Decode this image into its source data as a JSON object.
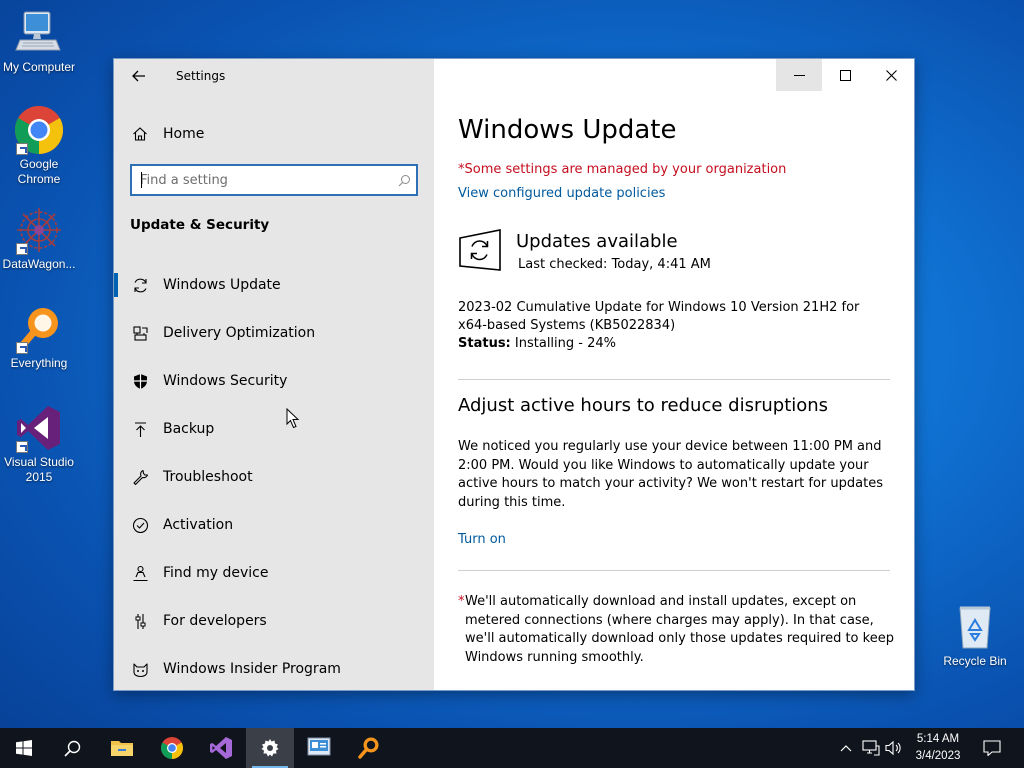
{
  "desktop": {
    "icons": [
      {
        "label": "My Computer"
      },
      {
        "label": "Google Chrome"
      },
      {
        "label": "DataWagon..."
      },
      {
        "label": "Everything"
      },
      {
        "label": "Visual Studio 2015"
      },
      {
        "label": "Recycle Bin"
      }
    ]
  },
  "window": {
    "title": "Settings",
    "controls": {
      "minimize": "minimize-icon",
      "maximize": "maximize-icon",
      "close": "close-icon"
    }
  },
  "sidebar": {
    "home_label": "Home",
    "search_placeholder": "Find a setting",
    "section_title": "Update & Security",
    "items": [
      {
        "label": "Windows Update",
        "icon": "sync-icon",
        "active": true
      },
      {
        "label": "Delivery Optimization",
        "icon": "delivery-optimization-icon"
      },
      {
        "label": "Windows Security",
        "icon": "shield-icon"
      },
      {
        "label": "Backup",
        "icon": "backup-icon"
      },
      {
        "label": "Troubleshoot",
        "icon": "wrench-icon"
      },
      {
        "label": "Activation",
        "icon": "check-circle-icon"
      },
      {
        "label": "Find my device",
        "icon": "person-pin-icon"
      },
      {
        "label": "For developers",
        "icon": "developer-sliders-icon"
      },
      {
        "label": "Windows Insider Program",
        "icon": "insider-cat-icon"
      }
    ]
  },
  "main": {
    "title": "Windows Update",
    "managed_notice": "*Some settings are managed by your organization",
    "policies_link": "View configured update policies",
    "update_heading": "Updates available",
    "last_checked": "Last checked: Today, 4:41 AM",
    "update_name": "2023-02 Cumulative Update for Windows 10 Version 21H2 for x64-based Systems (KB5022834)",
    "status_label": "Status:",
    "status_value": "Installing - 24%",
    "progress_percent": 24,
    "active_hours_heading": "Adjust active hours to reduce disruptions",
    "active_hours_text": "We noticed you regularly use your device between 11:00 PM and 2:00 PM. Would you like Windows to automatically update your active hours to match your activity? We won't restart for updates during this time.",
    "turn_on_link": "Turn on",
    "footnote_star": "*",
    "footnote_text": "We'll automatically download and install updates, except on metered connections (where charges may apply). In that case, we'll automatically download only those updates required to keep Windows running smoothly."
  },
  "taskbar": {
    "buttons": [
      "start-icon",
      "search-icon",
      "file-explorer-icon",
      "chrome-icon",
      "visual-studio-icon",
      "settings-icon",
      "datawagon-icon",
      "everything-icon"
    ],
    "tray": [
      "chevron-up-icon",
      "network-icon",
      "volume-icon",
      "notifications-icon"
    ],
    "time": "5:14 AM",
    "date": "3/4/2023"
  },
  "colors": {
    "accent": "#0063b1",
    "link": "#005a9e",
    "warning": "#c50f1f",
    "sidebar_bg": "#e6e6e6",
    "taskbar_bg": "#10141c"
  }
}
